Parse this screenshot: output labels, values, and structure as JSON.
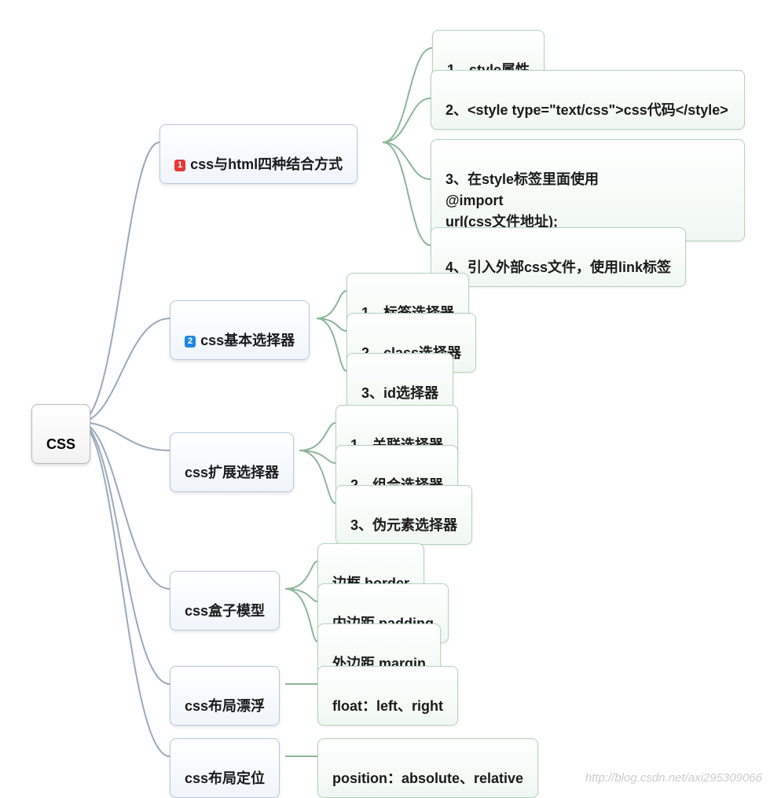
{
  "root": {
    "label": "CSS"
  },
  "b1": {
    "badge": "1",
    "label": "css与html四种结合方式"
  },
  "b1c1": {
    "label": "1、style属性"
  },
  "b1c2": {
    "label": "2、<style type=\"text/css\">css代码</style>"
  },
  "b1c3": {
    "label": "3、在style标签里面使用\n@import\nurl(css文件地址);"
  },
  "b1c4": {
    "label": "4、引入外部css文件，使用link标签"
  },
  "b2": {
    "badge": "2",
    "label": "css基本选择器"
  },
  "b2c1": {
    "label": "1、标签选择器"
  },
  "b2c2": {
    "label": "2、class选择器"
  },
  "b2c3": {
    "label": "3、id选择器"
  },
  "b3": {
    "label": "css扩展选择器"
  },
  "b3c1": {
    "label": "1、关联选择器"
  },
  "b3c2": {
    "label": "2、组合选择器"
  },
  "b3c3": {
    "label": "3、伪元素选择器"
  },
  "b4": {
    "label": "css盒子模型"
  },
  "b4c1": {
    "label": "边框 border"
  },
  "b4c2": {
    "label": "内边距 padding"
  },
  "b4c3": {
    "label": "外边距 margin"
  },
  "b5": {
    "label": "css布局漂浮"
  },
  "b5c1": {
    "label": "float：left、right"
  },
  "b6": {
    "label": "css布局定位"
  },
  "b6c1": {
    "label": "position：absolute、relative"
  },
  "watermark": "http://blog.csdn.net/axi295309066"
}
